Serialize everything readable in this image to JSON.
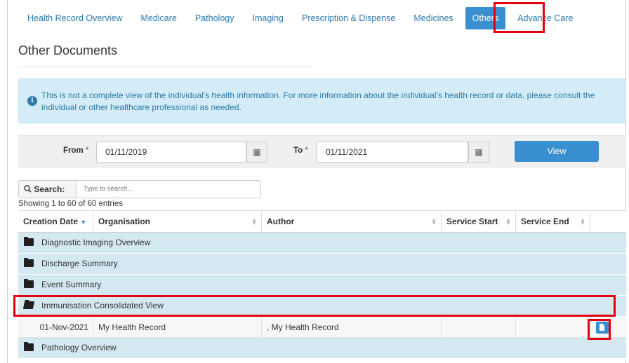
{
  "tabs": [
    {
      "label": "Health Record Overview"
    },
    {
      "label": "Medicare"
    },
    {
      "label": "Pathology"
    },
    {
      "label": "Imaging"
    },
    {
      "label": "Prescription & Dispense"
    },
    {
      "label": "Medicines"
    },
    {
      "label": "Others"
    },
    {
      "label": "Advance Care"
    }
  ],
  "page_title": "Other Documents",
  "info_message": "This is not a complete view of the individual's health information. For more information about the individual's health record or data, please consult the individual or other healthcare professional as needed.",
  "filter": {
    "from_label": "From",
    "from_value": "01/11/2019",
    "to_label": "To",
    "to_value": "01/11/2021",
    "required_mark": "*",
    "view_label": "View"
  },
  "search": {
    "label": "Search:",
    "placeholder": "Type to search..."
  },
  "showing_text": "Showing 1 to 60 of 60 entries",
  "table": {
    "columns": [
      "Creation Date",
      "Organisation",
      "Author",
      "Service Start",
      "Service End"
    ],
    "groups": [
      {
        "name": "Diagnostic Imaging Overview"
      },
      {
        "name": "Discharge Summary"
      },
      {
        "name": "Event Summary"
      },
      {
        "name": "Immunisation Consolidated View"
      },
      {
        "name": "Pathology Overview"
      }
    ],
    "row": {
      "creation_date": "01-Nov-2021",
      "organisation": "My Health Record",
      "author": ", My Health Record",
      "service_start": "",
      "service_end": ""
    }
  },
  "colors": {
    "accent": "#3a8fd0",
    "group_row": "#d4e8f2",
    "highlight": "#e3000f"
  }
}
